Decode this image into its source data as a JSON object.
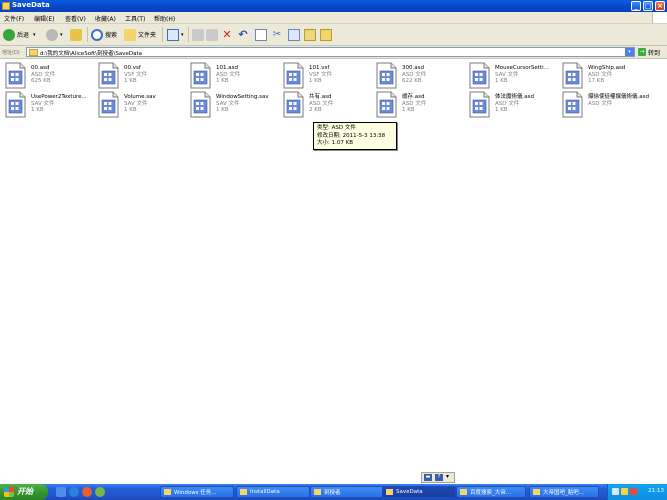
{
  "window": {
    "title": "SaveData"
  },
  "menu": [
    "文件(F)",
    "编辑(E)",
    "查看(V)",
    "收藏(A)",
    "工具(T)",
    "帮助(H)"
  ],
  "toolbar": {
    "back_label": "后退",
    "search_label": "搜索",
    "folders_label": "文件夹"
  },
  "address": {
    "label": "地址(D)",
    "path": "d:\\我的文档\\AliceSoft\\刻授者\\SaveData",
    "go_label": "转到"
  },
  "files": [
    {
      "name": "00.asd",
      "type": "ASD 文件",
      "size": "625 KB"
    },
    {
      "name": "00.vsf",
      "type": "VSF 文件",
      "size": "1 KB"
    },
    {
      "name": "101.asd",
      "type": "ASD 文件",
      "size": "1 KB"
    },
    {
      "name": "101.vsf",
      "type": "VSF 文件",
      "size": "1 KB"
    },
    {
      "name": "300.asd",
      "type": "ASD 文件",
      "size": "622 KB"
    },
    {
      "name": "MouseCursorSetti...",
      "type": "SAV 文件",
      "size": "1 KB"
    },
    {
      "name": "WingShip.asd",
      "type": "ASD 文件",
      "size": "17 KB"
    },
    {
      "name": "UsePower2Texture...",
      "type": "SAV 文件",
      "size": "1 KB"
    },
    {
      "name": "Volume.sav",
      "type": "SAV 文件",
      "size": "1 KB"
    },
    {
      "name": "WindowSetting.sav",
      "type": "SAV 文件",
      "size": "1 KB"
    },
    {
      "name": "共有.asd",
      "type": "ASD 文件",
      "size": "2 KB"
    },
    {
      "name": "缓存.asd",
      "type": "ASD 文件",
      "size": "1 KB"
    },
    {
      "name": "体法魔術儀.asd",
      "type": "ASD 文件",
      "size": "1 KB"
    },
    {
      "name": "爆徐使徒權撰儀術儀.asd",
      "type": "ASD 文件",
      "size": ""
    }
  ],
  "tooltip": {
    "type": "类型: ASD 文件",
    "modified": "修改日期: 2011-5-3 13:38",
    "size": "大小: 1.07 KB"
  },
  "taskbar": {
    "start_label": "开始",
    "tasks": [
      {
        "label": "Windows 任务..."
      },
      {
        "label": "InstallData"
      },
      {
        "label": "刻授者"
      },
      {
        "label": "SaveData"
      },
      {
        "label": "百度搜索_大帝..."
      },
      {
        "label": "大帝国吧_贴吧..."
      }
    ],
    "clock": "21:13"
  },
  "colors": {
    "titlebar": "#0846c8",
    "taskbar": "#245edb",
    "start": "#36962f",
    "tooltip_bg": "#ffffe1"
  }
}
